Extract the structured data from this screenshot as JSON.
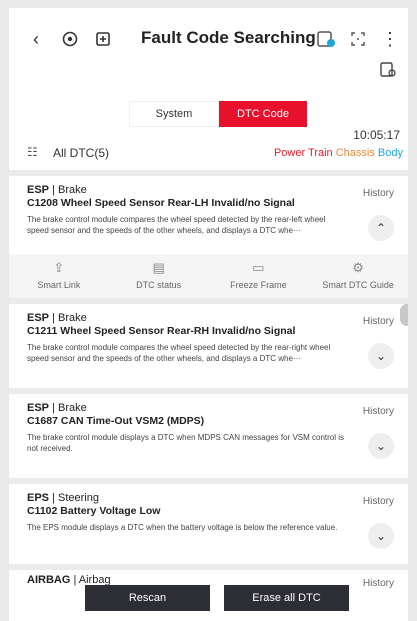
{
  "header": {
    "title": "Fault Code Searching",
    "back_icon": "chevron-left-icon",
    "icons": [
      "vehicle-icon",
      "add-device-icon",
      "device-info-icon",
      "expand-icon",
      "more-icon"
    ]
  },
  "tabs": {
    "system_label": "System",
    "dtc_label": "DTC Code",
    "active": "DTC Code"
  },
  "clock": "10:05:17",
  "list_header": {
    "label": "All DTC(5)",
    "filters": [
      "Power Train",
      "Chassis",
      "Body"
    ]
  },
  "colors": {
    "accent": "#e8112d",
    "powertrain": "#e11d2a",
    "chassis": "#e08a3c",
    "body": "#1ea7d6"
  },
  "dtcs": [
    {
      "module": "ESP",
      "system": "Brake",
      "code_text": "C1208 Wheel Speed Sensor Rear-LH Invalid/no Signal",
      "description": "The brake control module compares the wheel speed detected by the rear-left wheel speed sensor and the speeds of the other wheels, and displays a DTC whe···",
      "history": "History"
    },
    {
      "module": "ESP",
      "system": "Brake",
      "code_text": "C1211 Wheel Speed Sensor Rear-RH Invalid/no Signal",
      "description": "The brake control module compares the wheel speed detected by the rear-right wheel speed sensor and the speeds of the other wheels, and displays a DTC whe···",
      "history": "History"
    },
    {
      "module": "ESP",
      "system": "Brake",
      "code_text": "C1687 CAN Time-Out VSM2 (MDPS)",
      "description": "The brake control module displays a DTC when MDPS CAN messages for VSM control is not received.",
      "history": "History"
    },
    {
      "module": "EPS",
      "system": "Steering",
      "code_text": "C1102 Battery Voltage Low",
      "description": "The EPS module displays a DTC when the battery voltage is below the reference value.",
      "history": "History"
    },
    {
      "module": "AIRBAG",
      "system": "Airbag",
      "code_text": "",
      "description": "",
      "history": "History"
    }
  ],
  "actions": [
    {
      "label": "Smart Link",
      "icon": "share-icon"
    },
    {
      "label": "DTC status",
      "icon": "dtc-status-icon"
    },
    {
      "label": "Freeze Frame",
      "icon": "freeze-frame-icon"
    },
    {
      "label": "Smart DTC Guide",
      "icon": "guide-icon"
    }
  ],
  "bottom": {
    "rescan_label": "Rescan",
    "erase_label": "Erase all DTC"
  }
}
